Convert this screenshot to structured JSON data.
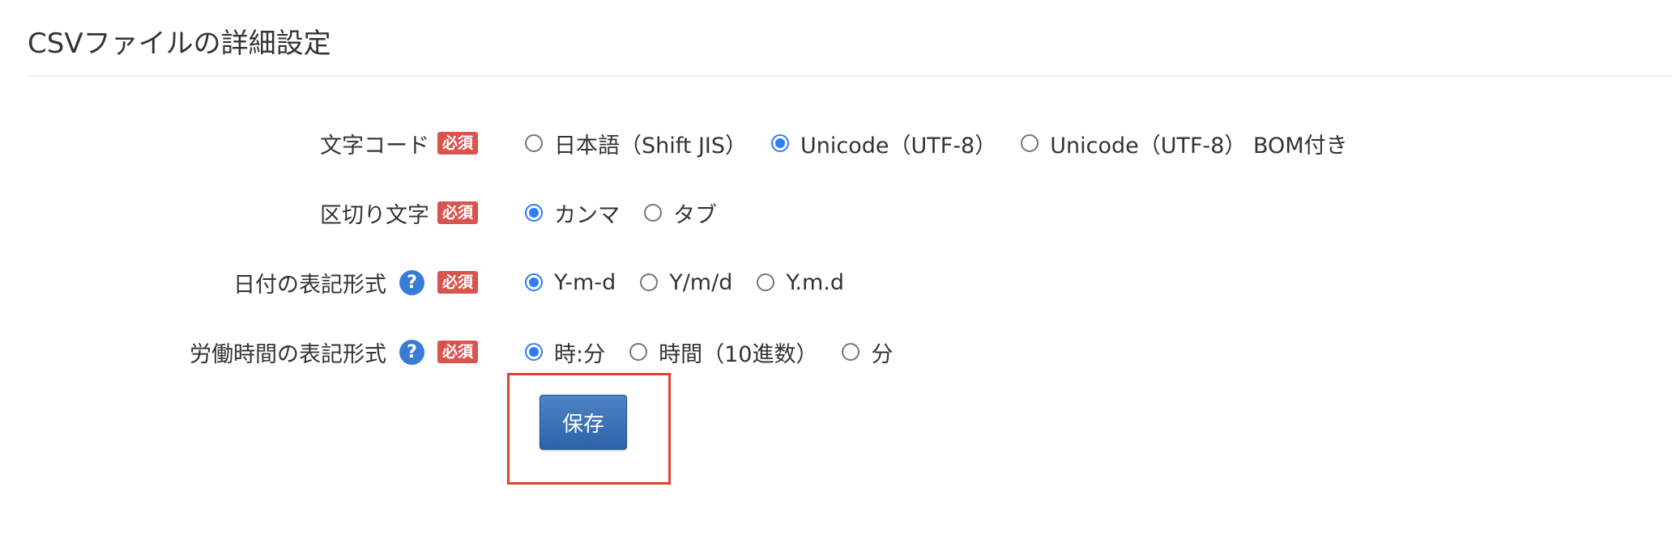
{
  "section": {
    "title": "CSVファイルの詳細設定"
  },
  "required_label": "必須",
  "help_label": "?",
  "rows": [
    {
      "label": "文字コード",
      "options": [
        {
          "label": "日本語（Shift JIS）",
          "checked": false
        },
        {
          "label": "Unicode（UTF-8）",
          "checked": true
        },
        {
          "label": "Unicode（UTF-8） BOM付き",
          "checked": false
        }
      ]
    },
    {
      "label": "区切り文字",
      "options": [
        {
          "label": "カンマ",
          "checked": true
        },
        {
          "label": "タブ",
          "checked": false
        }
      ]
    },
    {
      "label": "日付の表記形式",
      "options": [
        {
          "label": "Y-m-d",
          "checked": true
        },
        {
          "label": "Y/m/d",
          "checked": false
        },
        {
          "label": "Y.m.d",
          "checked": false
        }
      ]
    },
    {
      "label": "労働時間の表記形式",
      "options": [
        {
          "label": "時:分",
          "checked": true
        },
        {
          "label": "時間（10進数）",
          "checked": false
        },
        {
          "label": "分",
          "checked": false
        }
      ]
    }
  ],
  "save_button": {
    "label": "保存"
  },
  "colors": {
    "accent": "#2f7df6",
    "required_badge": "#d9534f",
    "help_icon": "#3a7bd5",
    "button": "#3a6fb5",
    "highlight": "#e0432e"
  }
}
